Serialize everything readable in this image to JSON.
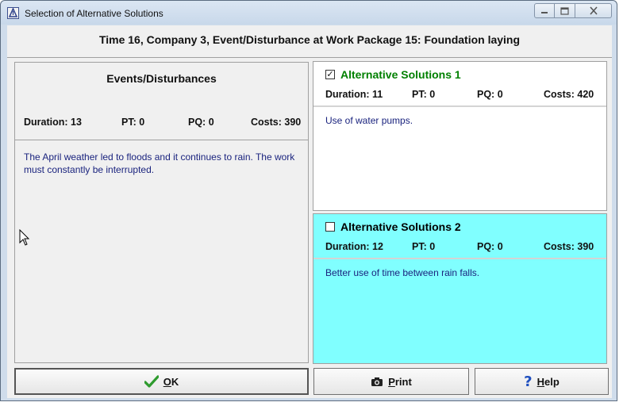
{
  "window": {
    "title": "Selection of Alternative Solutions"
  },
  "header": {
    "title": "Time 16, Company 3, Event/Disturbance at Work Package 15: Foundation laying"
  },
  "events": {
    "title": "Events/Disturbances",
    "duration": "Duration: 13",
    "pt": "PT: 0",
    "pq": "PQ: 0",
    "costs": "Costs: 390",
    "description": "The April weather led to floods and it continues to rain. The work must constantly be interrupted."
  },
  "alternatives": [
    {
      "title": "Alternative Solutions 1",
      "checked": true,
      "title_color": "#008000",
      "background": "#ffffff",
      "duration": "Duration: 11",
      "pt": "PT: 0",
      "pq": "PQ: 0",
      "costs": "Costs: 420",
      "description": "Use of water pumps."
    },
    {
      "title": "Alternative Solutions 2",
      "checked": false,
      "title_color": "#000000",
      "background": "#80ffff",
      "duration": "Duration: 12",
      "pt": "PT: 0",
      "pq": "PQ: 0",
      "costs": "Costs: 390",
      "description": "Better use of time between rain falls."
    }
  ],
  "buttons": {
    "ok": {
      "label_underlined": "O",
      "label_rest": "K",
      "icon": "checkmark-icon"
    },
    "print": {
      "label_underlined": "P",
      "label_rest": "rint",
      "icon": "camera-icon"
    },
    "help": {
      "label_underlined": "H",
      "label_rest": "elp",
      "icon": "question-icon"
    }
  },
  "colors": {
    "description_text": "#1a237e",
    "alt2_background": "#80ffff",
    "ok_check": "#2e9b2e",
    "help_question": "#1f4fbf"
  }
}
